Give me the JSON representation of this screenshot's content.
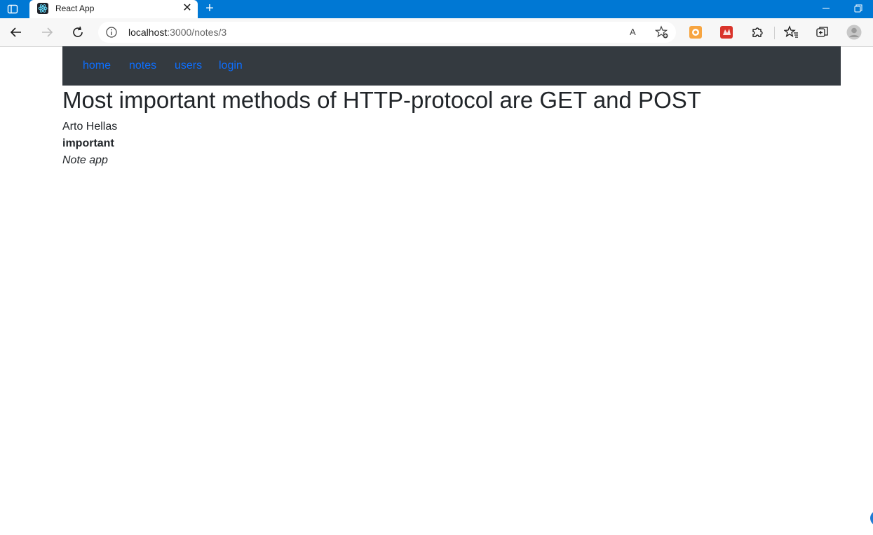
{
  "browser": {
    "tab_title": "React App",
    "tab_close": "✕",
    "new_tab": "+",
    "address": {
      "host": "localhost",
      "path": ":3000/notes/3"
    },
    "read_aloud": "A"
  },
  "nav": {
    "links": [
      {
        "label": "home"
      },
      {
        "label": "notes"
      },
      {
        "label": "users"
      },
      {
        "label": "login"
      }
    ]
  },
  "note": {
    "title": "Most important methods of HTTP-protocol are GET and POST",
    "author": "Arto Hellas",
    "importance": "important"
  },
  "footer": {
    "text": "Note app"
  },
  "colors": {
    "titlebar": "#0078d4",
    "navbar": "#343a40",
    "link": "#0d6efd"
  },
  "icons": {
    "window_menu": "window-menu-icon",
    "favicon": "react-logo-icon",
    "back": "back-arrow-icon",
    "forward": "forward-arrow-icon",
    "refresh": "refresh-icon",
    "info": "info-icon",
    "favorite_add": "favorite-add-icon",
    "extension_1": "extension-orange-icon",
    "extension_2": "extension-red-icon",
    "extensions": "puzzle-icon",
    "favorites": "favorites-icon",
    "collections": "collections-icon",
    "profile": "profile-avatar-icon"
  }
}
